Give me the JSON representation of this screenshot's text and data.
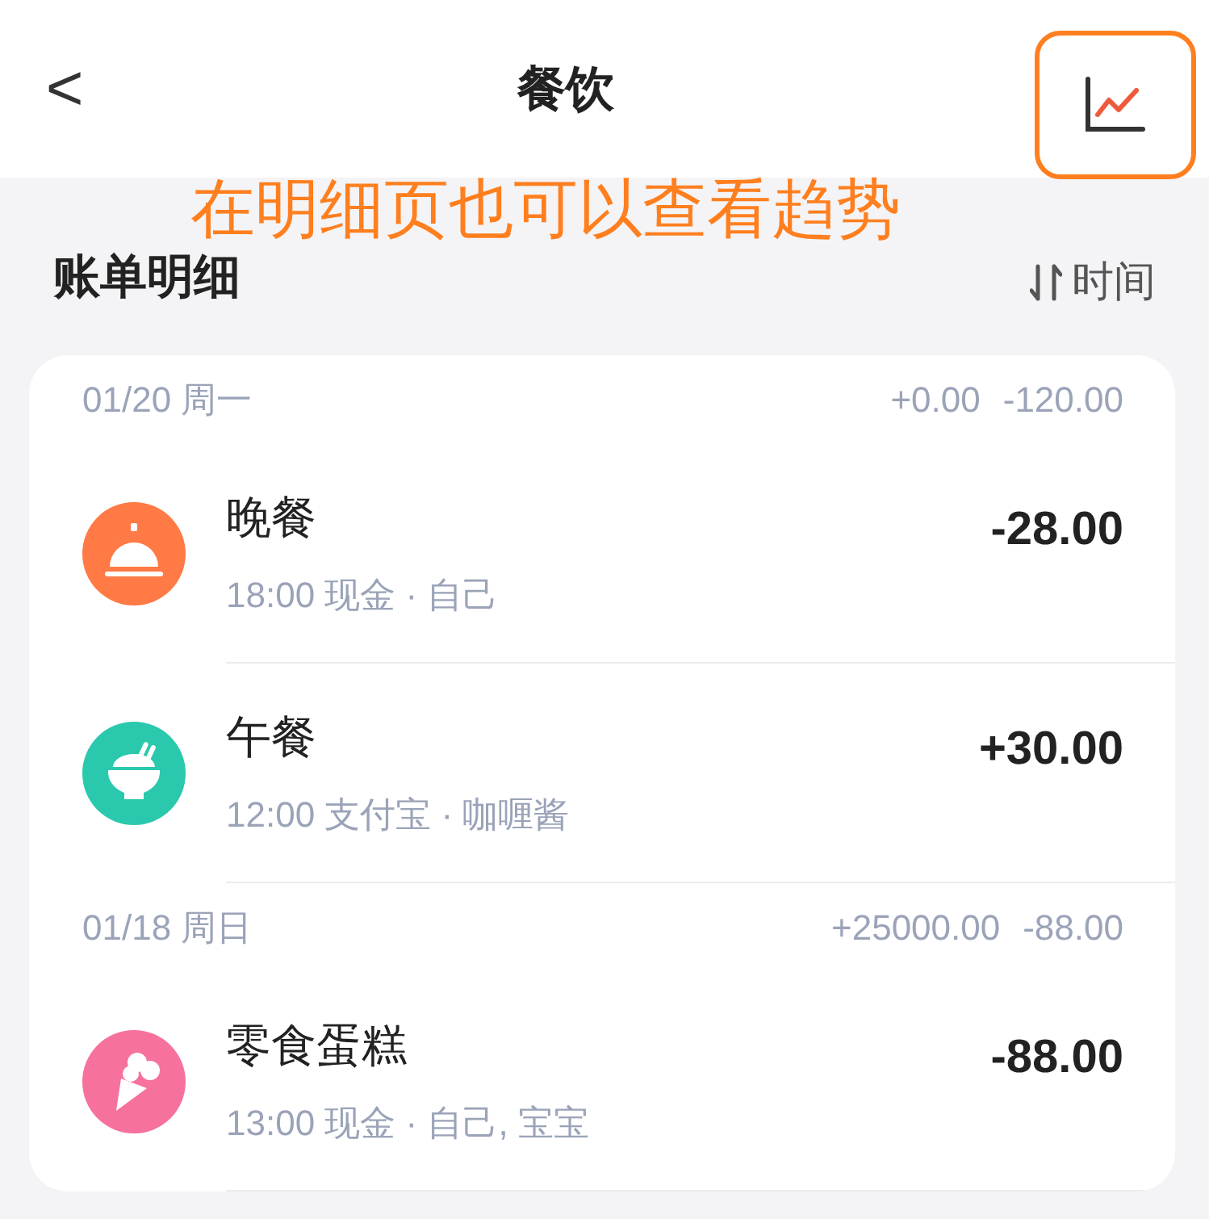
{
  "nav": {
    "back": "<",
    "title": "餐饮"
  },
  "annotation": {
    "text": "在明细页也可以查看趋势"
  },
  "section": {
    "title": "账单明细",
    "sort": "时间"
  },
  "groups": [
    {
      "date": "01/20 周一",
      "income": "+0.00",
      "expense": "-120.00",
      "items": [
        {
          "kind": "cloche",
          "color": "#ff7a45",
          "title": "晚餐",
          "meta": "18:00 现金 · 自己",
          "amount": "-28.00"
        },
        {
          "kind": "bowl",
          "color": "#2ac9ae",
          "title": "午餐",
          "meta": "12:00 支付宝 · 咖喱酱",
          "amount": "+30.00"
        }
      ]
    },
    {
      "date": "01/18 周日",
      "income": "+25000.00",
      "expense": "-88.00",
      "items": [
        {
          "kind": "icecream",
          "color": "#f7719d",
          "title": "零食蛋糕",
          "meta": "13:00 现金 · 自己, 宝宝",
          "amount": "-88.00"
        }
      ]
    }
  ]
}
